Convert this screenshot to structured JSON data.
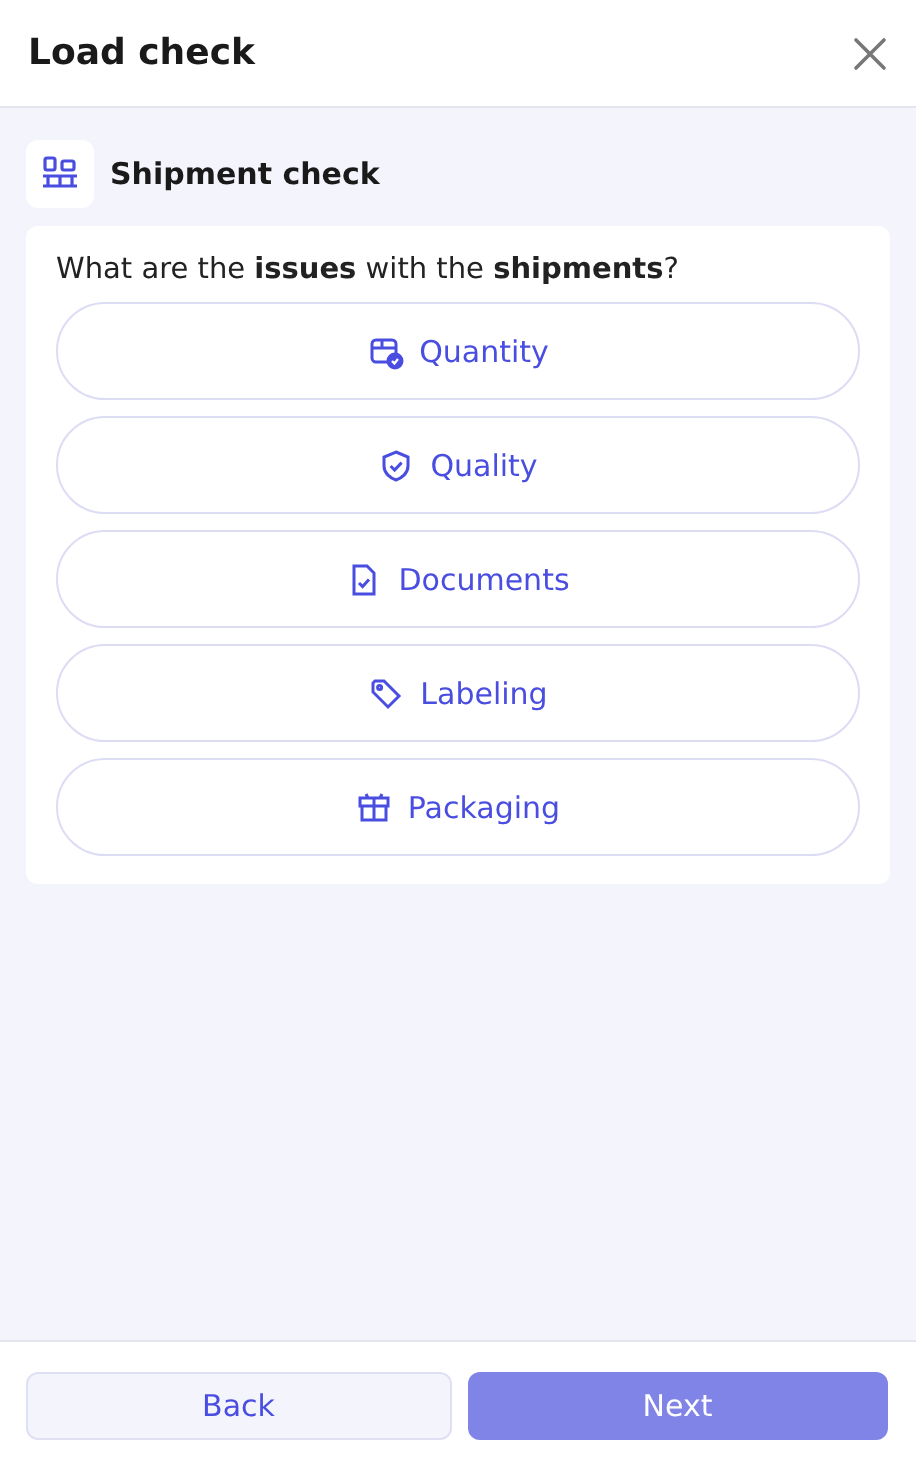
{
  "window": {
    "title": "Load check"
  },
  "section": {
    "title": "Shipment check"
  },
  "question": "What are the **issues** with the **shipments**?",
  "options": [
    {
      "label": "Quantity",
      "kind": "quantity",
      "selected": false
    },
    {
      "label": "Quality",
      "kind": "quality",
      "selected": false
    },
    {
      "label": "Documents",
      "kind": "documents",
      "selected": false
    },
    {
      "label": "Labeling",
      "kind": "labeling",
      "selected": false
    },
    {
      "label": "Packaging",
      "kind": "packaging",
      "selected": false
    }
  ],
  "buttons": {
    "back": {
      "label": "Back"
    },
    "next": {
      "label": "Next",
      "disabled": true
    }
  }
}
